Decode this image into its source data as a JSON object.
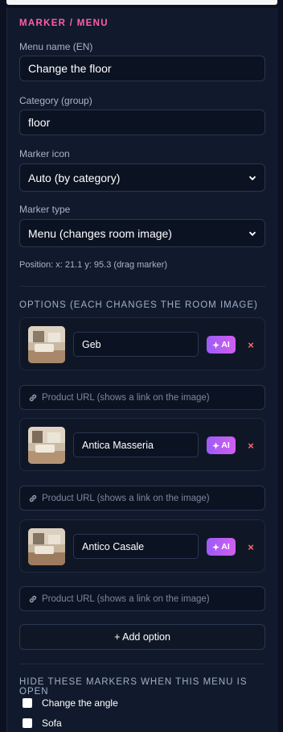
{
  "section": {
    "title": "MARKER / MENU"
  },
  "fields": {
    "menu_name": {
      "label": "Menu name (EN)",
      "value": "Change the floor"
    },
    "category": {
      "label": "Category (group)",
      "value": "floor"
    },
    "marker_icon": {
      "label": "Marker icon",
      "value": "Auto (by category)"
    },
    "marker_type": {
      "label": "Marker type",
      "value": "Menu (changes room image)"
    }
  },
  "position_note": "Position: x: 21.1 y: 95.3 (drag marker)",
  "options": {
    "title": "OPTIONS (EACH CHANGES THE ROOM IMAGE)",
    "ai_label": "AI",
    "remove_symbol": "×",
    "url_placeholder": "Product URL (shows a link on the image)",
    "items": [
      {
        "name": "Geb"
      },
      {
        "name": "Antica Masseria"
      },
      {
        "name": "Antico Casale"
      }
    ],
    "add_label": "+ Add option"
  },
  "hide_markers": {
    "title": "HIDE THESE MARKERS WHEN THIS MENU IS OPEN",
    "items": [
      {
        "label": "Change the angle",
        "checked": false
      },
      {
        "label": "Sofa",
        "checked": false
      }
    ]
  },
  "colors": {
    "accent_pink": "#ff5fa8",
    "ai_gradient_start": "#9c5cf6",
    "ai_gradient_end": "#d15ef0",
    "remove_red": "#ff6b6b",
    "panel_bg": "#111a2c",
    "page_bg": "#0b1120"
  }
}
